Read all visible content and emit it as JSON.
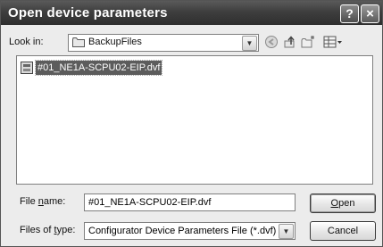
{
  "window": {
    "title": "Open device parameters"
  },
  "toolbar": {
    "look_in_label": "Look in:",
    "look_in_value": "BackupFiles"
  },
  "files": [
    {
      "name": "#01_NE1A-SCPU02-EIP.dvf",
      "selected": true
    }
  ],
  "form": {
    "file_name_label": "File name:",
    "file_name_value": "#01_NE1A-SCPU02-EIP.dvf",
    "files_of_type_label": "Files of type:",
    "files_of_type_value": "Configurator Device Parameters File (*.dvf)"
  },
  "buttons": {
    "open": "Open",
    "cancel": "Cancel",
    "help": "?",
    "close": "×"
  },
  "icons": [
    "help-icon",
    "close-icon",
    "folder-icon",
    "chevron-down-icon",
    "back-icon",
    "up-folder-icon",
    "new-folder-icon",
    "views-menu-icon",
    "file-icon"
  ],
  "colors": {
    "titlebar": "#3e3e3e",
    "selection": "#5c5c5c",
    "dialog_bg": "#ececec"
  }
}
